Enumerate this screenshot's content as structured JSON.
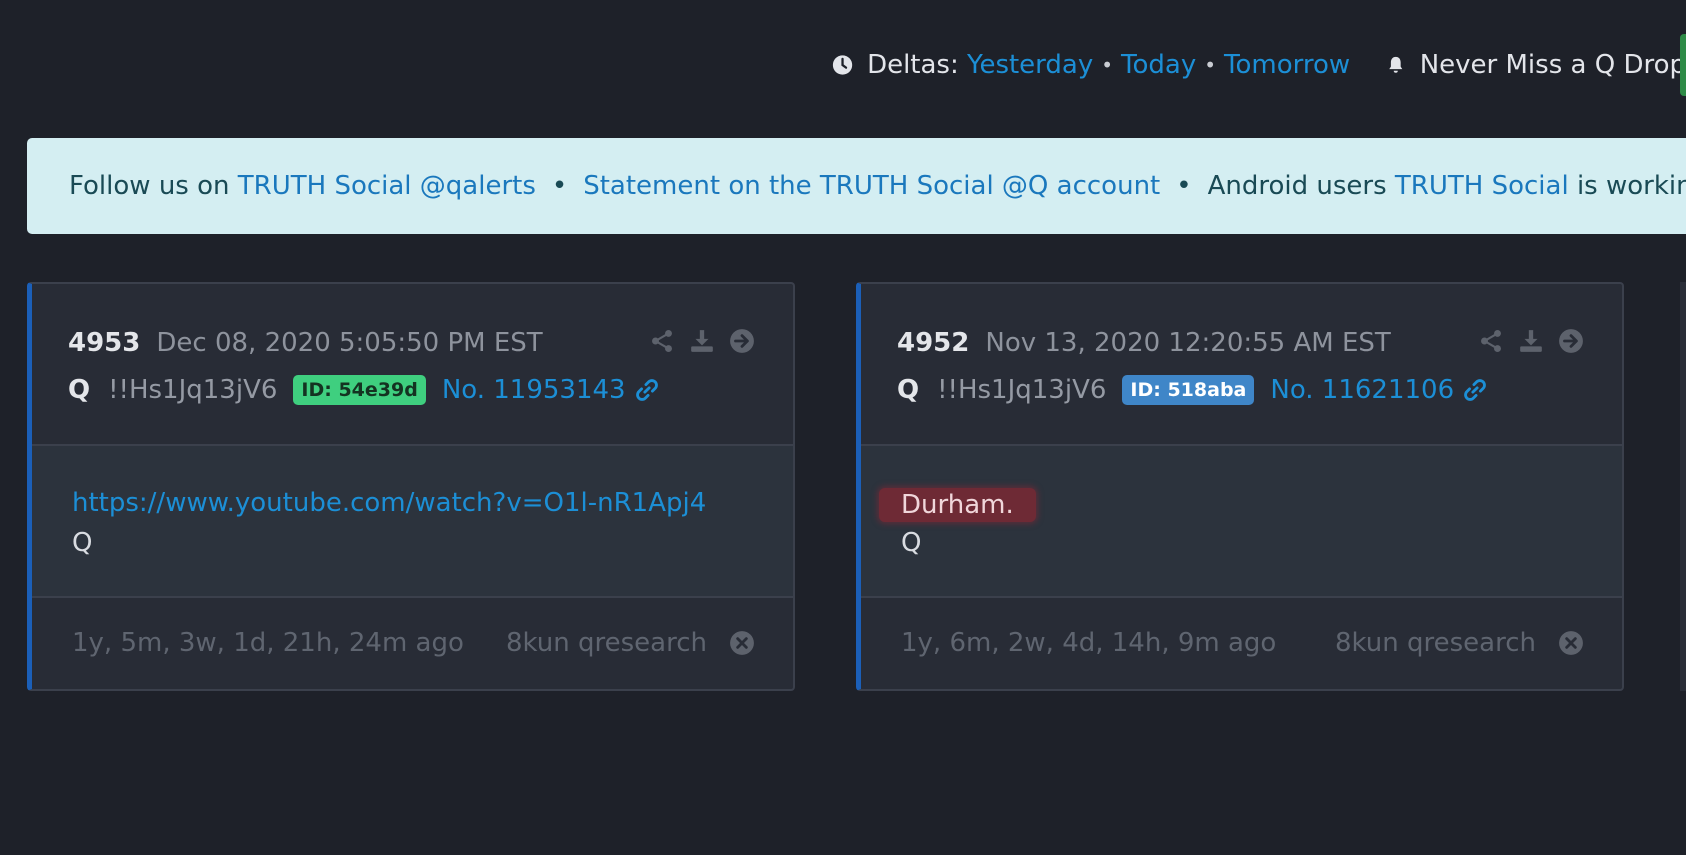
{
  "topbar": {
    "deltas_label": "Deltas:",
    "yesterday": "Yesterday",
    "today": "Today",
    "tomorrow": "Tomorrow",
    "separator": "•",
    "notify": "Never Miss a Q Drop"
  },
  "banner": {
    "prefix": "Follow us on",
    "link1": "TRUTH Social @qalerts",
    "dot": "•",
    "link2": "Statement on the TRUTH Social @Q account",
    "android_prefix": "Android users",
    "link3": "TRUTH Social",
    "suffix": "is working amazing"
  },
  "drops": [
    {
      "number": "4953",
      "date": "Dec 08, 2020 5:05:50 PM EST",
      "author": "Q",
      "tripcode": "!!Hs1Jq13jV6",
      "id_badge": "ID: 54e39d",
      "id_color": "#3fcf7f",
      "post_no": "No. 11953143",
      "body_link": "https://www.youtube.com/watch?v=O1l-nR1Apj4",
      "body_sign": "Q",
      "ago": "1y, 5m, 3w, 1d, 21h, 24m ago",
      "source": "8kun qresearch"
    },
    {
      "number": "4952",
      "date": "Nov 13, 2020 12:20:55 AM EST",
      "author": "Q",
      "tripcode": "!!Hs1Jq13jV6",
      "id_badge": "ID: 518aba",
      "id_color": "#3f86c8",
      "post_no": "No. 11621106",
      "body_text": "Durham.",
      "body_sign": "Q",
      "ago": "1y, 6m, 2w, 4d, 14h, 9m ago",
      "source": "8kun qresearch"
    }
  ],
  "icons": [
    "clock-icon",
    "bell-icon",
    "share-icon",
    "download-icon",
    "arrow-circle-right-icon",
    "link-icon",
    "close-circle-icon"
  ]
}
